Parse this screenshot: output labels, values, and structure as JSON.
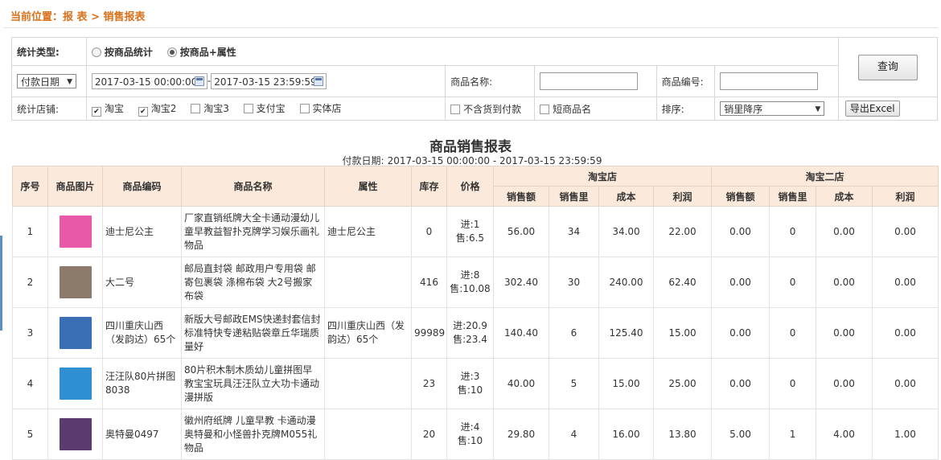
{
  "breadcrumb": {
    "prefix": "当前位置：",
    "path": "报 表 > 销售报表"
  },
  "filters": {
    "stat_type_label": "统计类型:",
    "stat_type_options": [
      {
        "label": "按商品统计",
        "selected": false
      },
      {
        "label": "按商品+属性",
        "selected": true
      }
    ],
    "date_type": "付款日期",
    "date_start": "2017-03-15 00:00:00",
    "date_sep": "-",
    "date_end": "2017-03-15 23:59:59",
    "product_name_label": "商品名称:",
    "product_name_value": "",
    "product_code_label": "商品编号:",
    "product_code_value": "",
    "query_button": "查询",
    "store_label": "统计店铺:",
    "stores": [
      {
        "label": "淘宝",
        "checked": true
      },
      {
        "label": "淘宝2",
        "checked": true
      },
      {
        "label": "淘宝3",
        "checked": false
      },
      {
        "label": "支付宝",
        "checked": false
      },
      {
        "label": "实体店",
        "checked": false
      }
    ],
    "exclude_cod": {
      "label": "不含货到付款",
      "checked": false
    },
    "short_name": {
      "label": "短商品名",
      "checked": false
    },
    "sort_label": "排序:",
    "sort_value": "销里降序",
    "export_button": "导出Excel"
  },
  "report": {
    "title": "商品销售报表",
    "subtitle_label": "付款日期:",
    "subtitle_range": "2017-03-15 00:00:00 - 2017-03-15 23:59:59"
  },
  "table": {
    "headers": {
      "seq": "序号",
      "image": "商品图片",
      "code": "商品编码",
      "name": "商品名称",
      "attr": "属性",
      "stock": "库存",
      "price": "价格",
      "group1": "淘宝店",
      "group2": "淘宝二店",
      "sub": [
        "销售额",
        "销售里",
        "成本",
        "利润"
      ]
    },
    "rows": [
      {
        "seq": "1",
        "thumb_color": "#e85aa8",
        "code": "迪士尼公主",
        "name": "厂家直销纸牌大全卡通动漫幼儿童早教益智扑克牌学习娱乐画礼物品",
        "attr": "迪士尼公主",
        "stock": "0",
        "price_in": "进:1",
        "price_out": "售:6.5",
        "s1": {
          "sales": "56.00",
          "qty": "34",
          "cost": "34.00",
          "profit": "22.00"
        },
        "s2": {
          "sales": "0.00",
          "qty": "0",
          "cost": "0.00",
          "profit": "0.00"
        }
      },
      {
        "seq": "2",
        "thumb_color": "#8c7a6a",
        "code": "大二号",
        "name": "邮局直封袋 邮政用户专用袋 邮寄包裹袋 涤棉布袋 大2号搬家布袋",
        "attr": "",
        "stock": "416",
        "price_in": "进:8",
        "price_out": "售:10.08",
        "s1": {
          "sales": "302.40",
          "qty": "30",
          "cost": "240.00",
          "profit": "62.40"
        },
        "s2": {
          "sales": "0.00",
          "qty": "0",
          "cost": "0.00",
          "profit": "0.00"
        }
      },
      {
        "seq": "3",
        "thumb_color": "#3a6fb5",
        "code": "四川重庆山西（发韵达）65个",
        "name": "新版大号邮政EMS快递封套信封标准特快专递粘贴袋章丘华瑞质量好",
        "attr": "四川重庆山西（发韵达）65个",
        "stock": "99989",
        "price_in": "进:20.9",
        "price_out": "售:23.4",
        "s1": {
          "sales": "140.40",
          "qty": "6",
          "cost": "125.40",
          "profit": "15.00"
        },
        "s2": {
          "sales": "0.00",
          "qty": "0",
          "cost": "0.00",
          "profit": "0.00"
        }
      },
      {
        "seq": "4",
        "thumb_color": "#2f8fd0",
        "code": "汪汪队80片拼图8038",
        "name": "80片积木制木质幼儿童拼图早教宝宝玩具汪汪队立大功卡通动漫拼版",
        "attr": "",
        "stock": "23",
        "price_in": "进:3",
        "price_out": "售:10",
        "s1": {
          "sales": "40.00",
          "qty": "5",
          "cost": "15.00",
          "profit": "25.00"
        },
        "s2": {
          "sales": "0.00",
          "qty": "0",
          "cost": "0.00",
          "profit": "0.00"
        }
      },
      {
        "seq": "5",
        "thumb_color": "#5b3a6e",
        "code": "奥特曼0497",
        "name": "徽州府纸牌 儿童早教 卡通动漫奥特曼和小怪兽扑克牌M055礼物品",
        "attr": "",
        "stock": "20",
        "price_in": "进:4",
        "price_out": "售:10",
        "s1": {
          "sales": "29.80",
          "qty": "4",
          "cost": "16.00",
          "profit": "13.80"
        },
        "s2": {
          "sales": "5.00",
          "qty": "1",
          "cost": "4.00",
          "profit": "1.00"
        }
      }
    ]
  }
}
